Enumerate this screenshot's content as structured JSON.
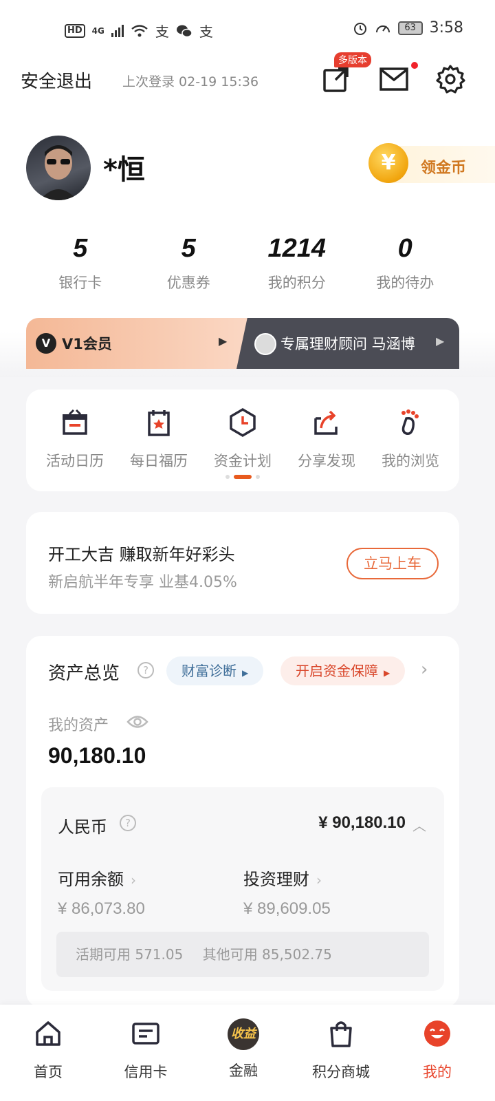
{
  "status_bar": {
    "hd": "HD",
    "network": "4G",
    "battery": "63",
    "time": "3:58"
  },
  "header": {
    "logout": "安全退出",
    "last_login": "上次登录 02-19 15:36",
    "multi_version_badge": "多版本"
  },
  "profile": {
    "name": "*恒",
    "coin_label": "领金币",
    "coin_symbol": "¥"
  },
  "stats": [
    {
      "value": "5",
      "label": "银行卡"
    },
    {
      "value": "5",
      "label": "优惠券"
    },
    {
      "value": "1214",
      "label": "我的积分"
    },
    {
      "value": "0",
      "label": "我的待办"
    }
  ],
  "member": {
    "level": "V1会员",
    "advisor": "专属理财顾问 马涵博"
  },
  "quick_menu": [
    {
      "label": "活动日历",
      "icon": "gift-calendar-icon"
    },
    {
      "label": "每日福历",
      "icon": "daily-calendar-icon"
    },
    {
      "label": "资金计划",
      "icon": "clock-plan-icon"
    },
    {
      "label": "分享发现",
      "icon": "share-icon"
    },
    {
      "label": "我的浏览",
      "icon": "footprint-icon"
    }
  ],
  "promo": {
    "title": "开工大吉 赚取新年好彩头",
    "subtitle": "新启航半年专享 业基4.05%",
    "button": "立马上车"
  },
  "assets": {
    "title": "资产总览",
    "pill_wealth": "财富诊断",
    "pill_protect": "开启资金保障",
    "my_assets_label": "我的资产",
    "total": "90,180.10",
    "currency_label": "人民币",
    "currency_amount": "¥ 90,180.10",
    "available_label": "可用余额",
    "available_value": "¥ 86,073.80",
    "invest_label": "投资理财",
    "invest_value": "¥ 89,609.05",
    "current_available": "活期可用  571.05",
    "other_available": "其他可用  85,502.75"
  },
  "tabs": [
    {
      "label": "首页",
      "icon": "home-icon"
    },
    {
      "label": "信用卡",
      "icon": "credit-card-icon"
    },
    {
      "label": "金融",
      "icon": "finance-icon",
      "badge": "收益"
    },
    {
      "label": "积分商城",
      "icon": "shopping-bag-icon"
    },
    {
      "label": "我的",
      "icon": "profile-smile-icon"
    }
  ],
  "colors": {
    "accent": "#e8432a",
    "orange": "#e8693a",
    "dark_banner": "#4b4c55"
  }
}
